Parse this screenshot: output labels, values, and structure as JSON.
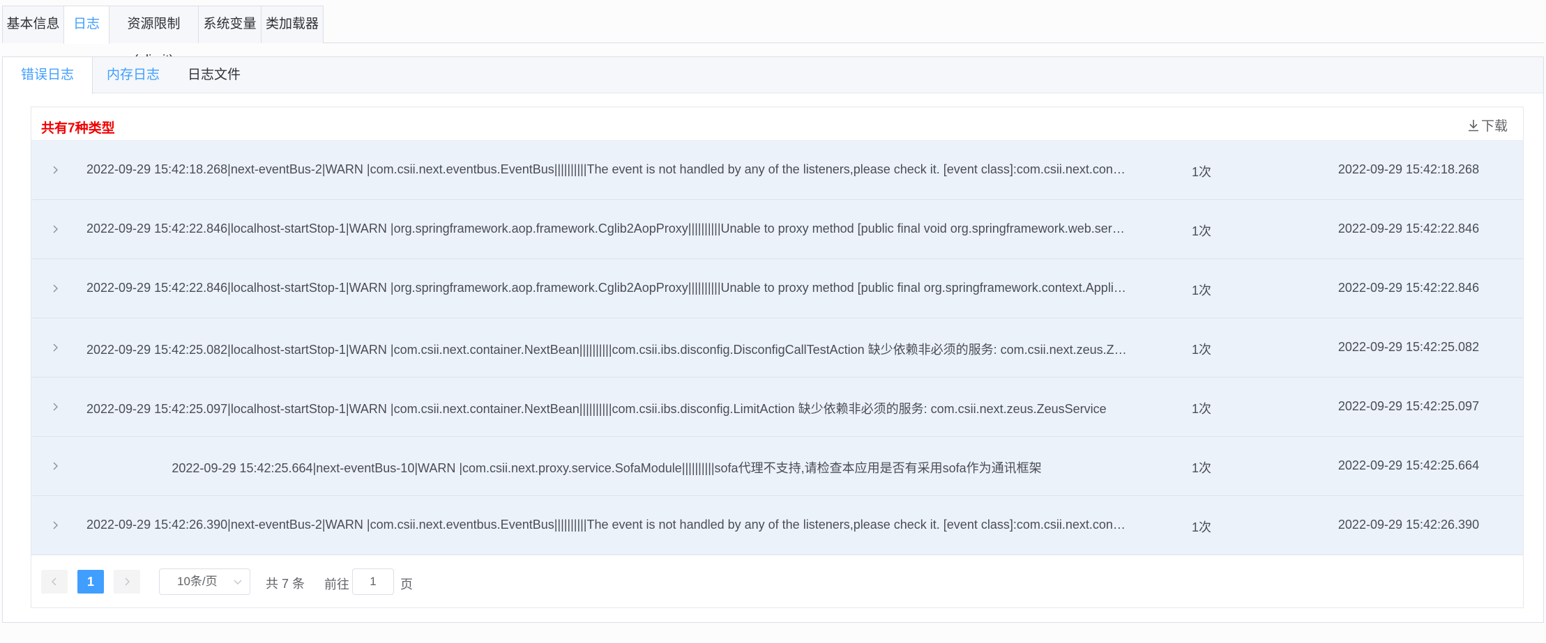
{
  "top_tabs": [
    {
      "label": "基本信息",
      "active": false
    },
    {
      "label": "日志",
      "active": true
    },
    {
      "label": "资源限制(ulimit)",
      "active": false
    },
    {
      "label": "系统变量",
      "active": false
    },
    {
      "label": "类加载器",
      "active": false
    }
  ],
  "sub_tabs": [
    {
      "label": "错误日志",
      "active": true
    },
    {
      "label": "内存日志",
      "active": false
    },
    {
      "label": "日志文件",
      "active": false
    }
  ],
  "summary": {
    "type_count_text": "共有7种类型",
    "download_label": "下载"
  },
  "rows": [
    {
      "message": "2022-09-29 15:42:18.268|next-eventBus-2|WARN |com.csii.next.eventbus.EventBus||||||||||The event is not handled by any of the listeners,please check it. [event class]:com.csii.next.container.event.ContainerRefreshedEvent",
      "count": "1次",
      "time": "2022-09-29 15:42:18.268"
    },
    {
      "message": "2022-09-29 15:42:22.846|localhost-startStop-1|WARN |org.springframework.aop.framework.Cglib2AopProxy||||||||||Unable to proxy method [public final void org.springframework.web.servlet.DispatcherServlet]",
      "count": "1次",
      "time": "2022-09-29 15:42:22.846"
    },
    {
      "message": "2022-09-29 15:42:22.846|localhost-startStop-1|WARN |org.springframework.aop.framework.Cglib2AopProxy||||||||||Unable to proxy method [public final org.springframework.context.ApplicationContext]",
      "count": "1次",
      "time": "2022-09-29 15:42:22.846"
    },
    {
      "message": "2022-09-29 15:42:25.082|localhost-startStop-1|WARN |com.csii.next.container.NextBean||||||||||com.csii.ibs.disconfig.DisconfigCallTestAction 缺少依赖非必须的服务: com.csii.next.zeus.ZeusService",
      "count": "1次",
      "time": "2022-09-29 15:42:25.082"
    },
    {
      "message": "2022-09-29 15:42:25.097|localhost-startStop-1|WARN |com.csii.next.container.NextBean||||||||||com.csii.ibs.disconfig.LimitAction 缺少依赖非必须的服务: com.csii.next.zeus.ZeusService",
      "count": "1次",
      "time": "2022-09-29 15:42:25.097"
    },
    {
      "message": "2022-09-29 15:42:25.664|next-eventBus-10|WARN |com.csii.next.proxy.service.SofaModule||||||||||sofa代理不支持,请检查本应用是否有采用sofa作为通讯框架",
      "count": "1次",
      "time": "2022-09-29 15:42:25.664"
    },
    {
      "message": "2022-09-29 15:42:26.390|next-eventBus-2|WARN |com.csii.next.eventbus.EventBus||||||||||The event is not handled by any of the listeners,please check it. [event class]:com.csii.next.container.event.ContainerStartedEvent",
      "count": "1次",
      "time": "2022-09-29 15:42:26.390"
    }
  ],
  "pagination": {
    "current_page": "1",
    "page_size_label": "10条/页",
    "total_text": "共 7 条",
    "goto_label": "前往",
    "goto_value": "1",
    "page_suffix": "页"
  },
  "colors": {
    "accent": "#409eff",
    "type_count": "#f00000",
    "row_background": "#ecf2fa"
  }
}
